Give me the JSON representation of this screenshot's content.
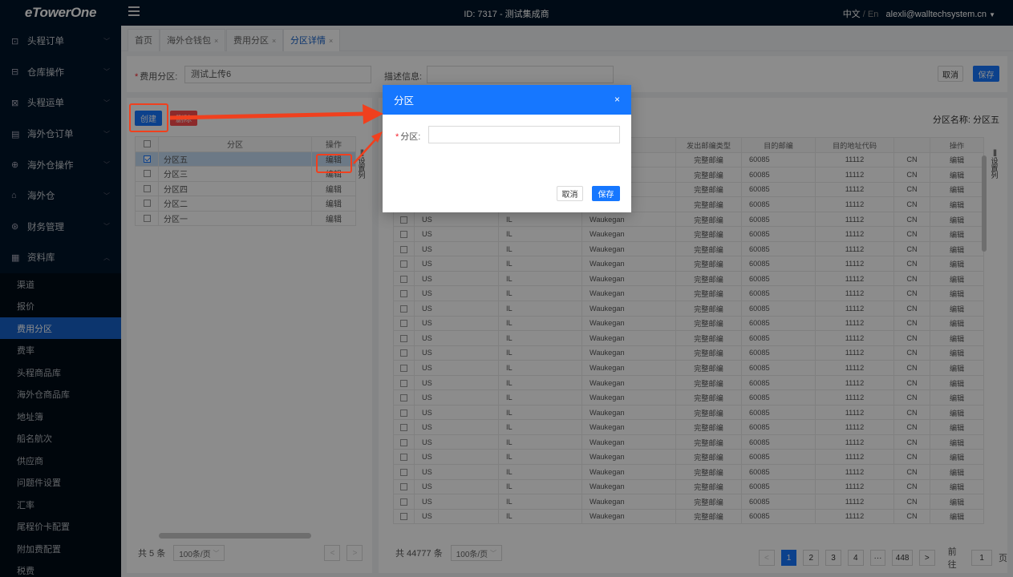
{
  "header": {
    "logo": "eTowerOne",
    "title": "ID: 7317 - 测试集成商",
    "lang_cn": "中文",
    "lang_sep": "/",
    "lang_en": "En",
    "user": "alexli@walltechsystem.cn",
    "user_caret": "▼"
  },
  "sidebar": {
    "items": [
      {
        "label": "头程订单",
        "icon": "⊡"
      },
      {
        "label": "仓库操作",
        "icon": "⊟"
      },
      {
        "label": "头程运单",
        "icon": "⊠"
      },
      {
        "label": "海外仓订单",
        "icon": "▤"
      },
      {
        "label": "海外仓操作",
        "icon": "⊕"
      },
      {
        "label": "海外仓",
        "icon": "⌂"
      },
      {
        "label": "财务管理",
        "icon": "⊛"
      },
      {
        "label": "资料库",
        "icon": "▦"
      }
    ],
    "arrow_down": "﹀",
    "arrow_up": "︿",
    "sub_items": [
      "渠道",
      "报价",
      "费用分区",
      "费率",
      "头程商品库",
      "海外仓商品库",
      "地址簿",
      "船名航次",
      "供应商",
      "问题件设置",
      "汇率",
      "尾程价卡配置",
      "附加费配置",
      "税费"
    ],
    "active_sub": "费用分区"
  },
  "tabs": [
    {
      "label": "首页",
      "close": ""
    },
    {
      "label": "海外仓钱包",
      "close": "×"
    },
    {
      "label": "费用分区",
      "close": "×"
    },
    {
      "label": "分区详情",
      "close": "×"
    }
  ],
  "form": {
    "zone_label": "费用分区:",
    "zone_value": "测试上传6",
    "desc_label": "描述信息:",
    "desc_value": "",
    "cancel": "取消",
    "save": "保存"
  },
  "left": {
    "create": "创建",
    "delete": "删除",
    "col_zone": "分区",
    "col_op": "操作",
    "rows": [
      {
        "name": "分区五",
        "op": "编辑",
        "checked": true
      },
      {
        "name": "分区三",
        "op": "编辑",
        "checked": false
      },
      {
        "name": "分区四",
        "op": "编辑",
        "checked": false
      },
      {
        "name": "分区二",
        "op": "编辑",
        "checked": false
      },
      {
        "name": "分区一",
        "op": "编辑",
        "checked": false
      }
    ],
    "set_col": "设置列",
    "set_col_glyph": "|||",
    "total": "共 5 条",
    "page_size": "100条/页",
    "caret": "﹀",
    "prev": "<",
    "next": ">"
  },
  "right": {
    "zone_name": "分区名称: 分区五",
    "headers": [
      "",
      "",
      "",
      "",
      "发出邮编类型",
      "目的邮编",
      "目的地址代码",
      "",
      "操作"
    ],
    "row": {
      "country": "US",
      "state": "IL",
      "city": "Waukegan",
      "type": "完整邮编",
      "zip": "60085",
      "code": "11112",
      "cc": "CN",
      "op": "编辑"
    },
    "row_count": 25,
    "set_col": "设置列",
    "set_col_glyph": "|||",
    "total": "共 44777 条",
    "page_size": "100条/页",
    "caret": "﹀",
    "pages": [
      "1",
      "2",
      "3",
      "4",
      "···",
      "448"
    ],
    "prev": "<",
    "next": ">",
    "goto": "前往",
    "goto_value": "1",
    "page_unit": "页"
  },
  "modal": {
    "title": "分区",
    "close": "×",
    "field_label": "分区:",
    "field_value": "",
    "cancel": "取消",
    "save": "保存"
  },
  "colors": {
    "primary": "#1677ff",
    "sidebar_bg": "#001529",
    "highlight": "#f0401e"
  }
}
